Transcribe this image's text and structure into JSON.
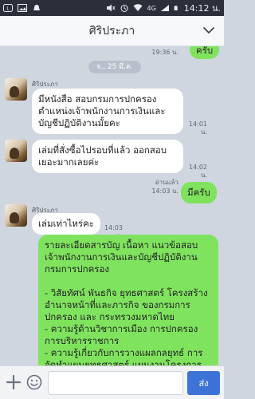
{
  "statusbar": {
    "network": "4G",
    "time": "14:12 น."
  },
  "header": {
    "title": "ศิริประภา"
  },
  "chat": {
    "date_chip": "จ., 25 มี.ค.",
    "messages": [
      {
        "direction": "out",
        "text": "ครับ",
        "time": "19:36 น."
      },
      {
        "direction": "in",
        "sender": "ศิริประภา",
        "text": "มีหนังสือ สอบกรมการปกครอง ตำแหน่งเจ้าพนักงานการเงินและบัญชีปฏิบัติงานมั้ยคะ",
        "time": "14:01 น."
      },
      {
        "direction": "in",
        "text": "เล่มที่สั่งซื้อไปรอบที่แล้ว ออกสอบเยอะมากเลยค่ะ",
        "time": "14:02 น."
      },
      {
        "direction": "out",
        "text": "มีครับ",
        "read": "อ่านแล้ว",
        "time": "14:03 น."
      },
      {
        "direction": "in",
        "sender": "ศิริประภา",
        "text": "เล่มเท่าไหร่คะ",
        "time": "14:03 น."
      },
      {
        "direction": "out",
        "text": "รายละเอียดสารบัญ เนื้อหา แนวข้อสอบ เจ้าพนักงานการเงินและบัญชีปฏิบัติงาน กรมการปกครอง\n\n- วิสัยทัศน์ พันธกิจ ยุทธศาสตร์ โครงสร้าง อำนาจหน้าที่และภารกิจ ของกรมการปกครอง และ กระทรวงมหาดไทย\n- ความรู้ด้านวิชาการเมือง การปกครอง การบริหารราชการ\n- ความรู้เกี่ยวกับการวางแผลกลยุทธ์ การจัดทำแผนยุทธศาสตร์ แผนงานโครงการ"
      }
    ]
  },
  "inputbar": {
    "placeholder": "",
    "send_label": "ส่ง"
  },
  "colors": {
    "outgoing_bubble": "#7fe35e",
    "incoming_bubble": "#ffffff",
    "chat_background": "#cfd6df",
    "send_button": "#3d73d6"
  }
}
